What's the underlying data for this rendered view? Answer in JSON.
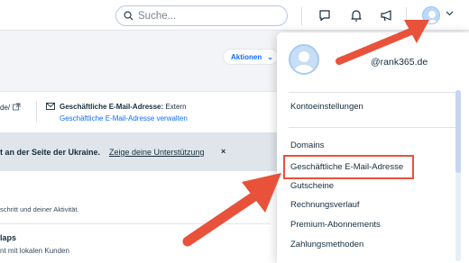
{
  "topbar": {
    "search_placeholder": "Suche...",
    "icons": [
      "search-icon",
      "chat-icon",
      "bell-icon",
      "megaphone-icon",
      "avatar",
      "chevron-down-icon"
    ]
  },
  "header": {
    "actions_label": "Aktionen"
  },
  "info": {
    "left_fragment": "de/",
    "email_label": "Geschäftliche E-Mail-Adresse:",
    "email_value": "Extern",
    "email_link": "Geschäftliche E-Mail-Adresse verwalten"
  },
  "banner": {
    "text": "t an der Seite der Ukraine.",
    "link": "Zeige deine Unterstützung",
    "close": "×"
  },
  "body": {
    "activity_text": "schritt und deiner Aktivität.",
    "card_title": "laps",
    "card_sub": "nt mit lokalen Kunden"
  },
  "dropdown": {
    "account": "@rank365.de",
    "items": [
      "Kontoeinstellungen",
      "Domains",
      "Geschäftliche E-Mail-Adresse",
      "Gutscheine",
      "Rechnungsverlauf",
      "Premium-Abonnements",
      "Zahlungsmethoden"
    ]
  },
  "colors": {
    "accent": "#116dff",
    "annotation": "#e8523a"
  }
}
